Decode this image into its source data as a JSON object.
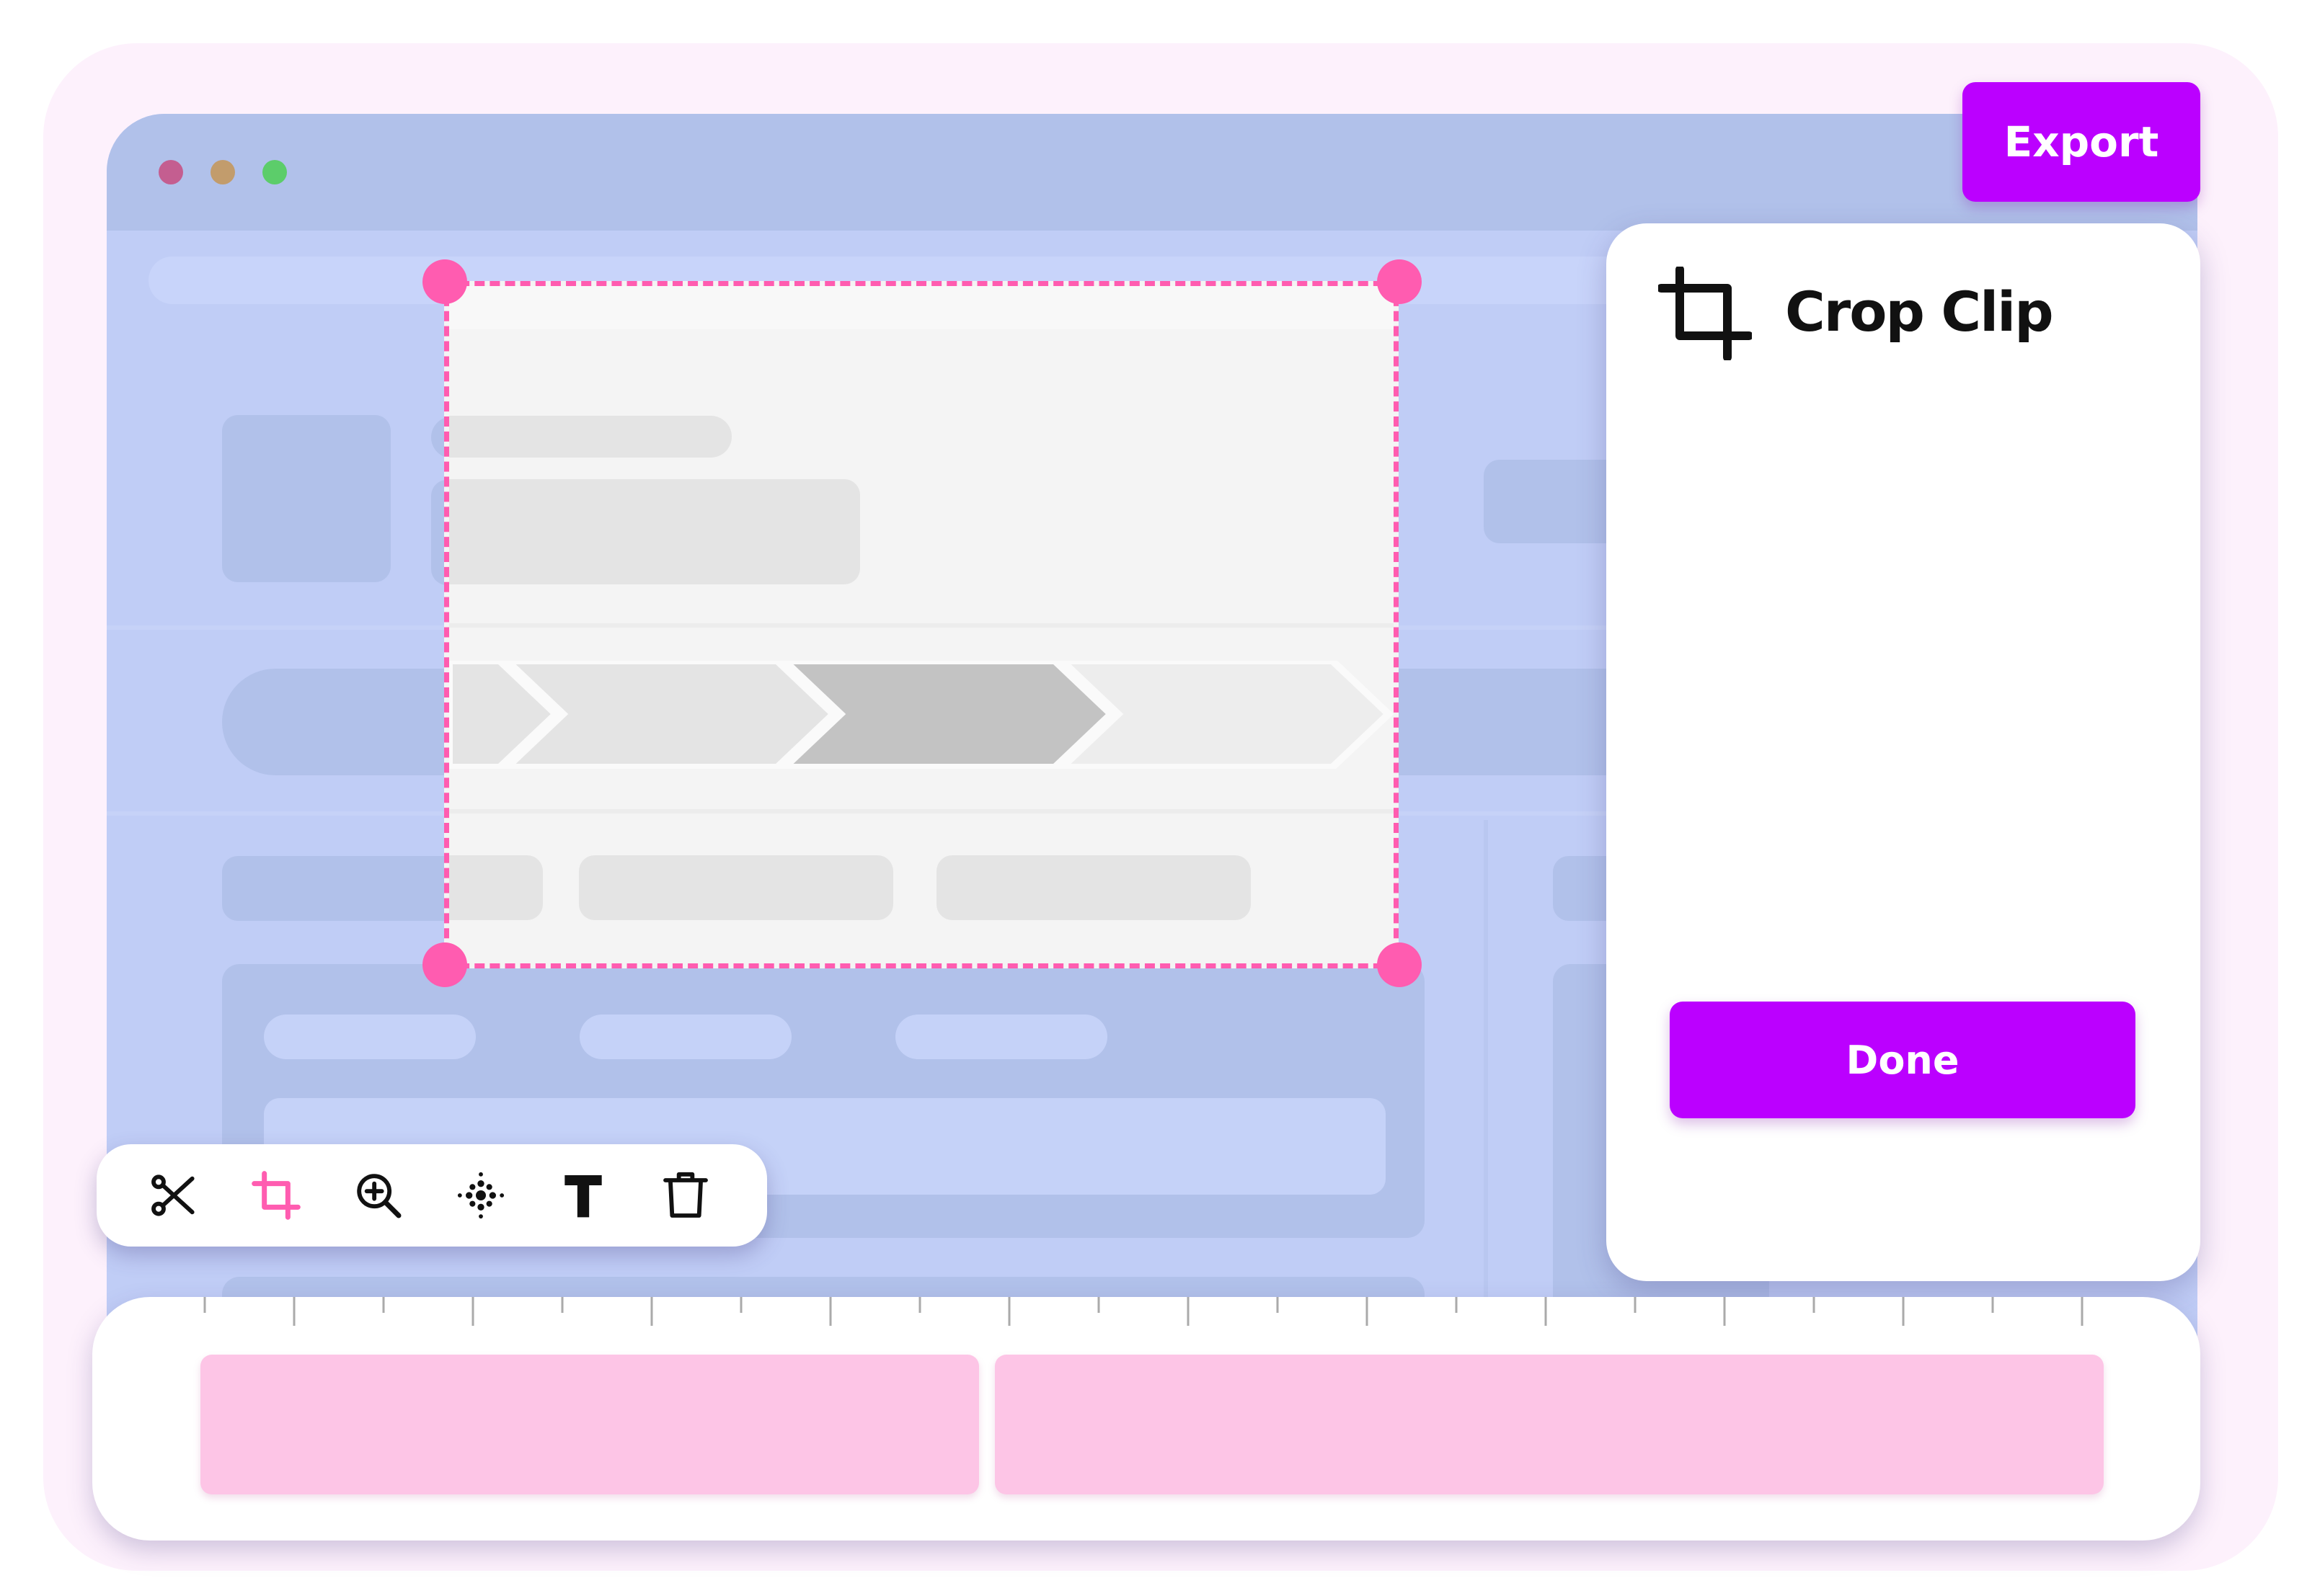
{
  "window": {
    "controls": [
      "close-dot",
      "minimize-dot",
      "maximize-dot"
    ],
    "control_colors": [
      "#c45e90",
      "#c29c6c",
      "#5ccd6a"
    ]
  },
  "header": {
    "export_label": "Export"
  },
  "crop_panel": {
    "icon": "crop-icon",
    "title": "Crop Clip",
    "done_label": "Done"
  },
  "toolbar": {
    "tools": [
      {
        "name": "scissors-icon",
        "active": false
      },
      {
        "name": "crop-icon",
        "active": true
      },
      {
        "name": "zoom-in-icon",
        "active": false
      },
      {
        "name": "sparkle-effects-icon",
        "active": false
      },
      {
        "name": "text-icon",
        "active": false
      },
      {
        "name": "trash-icon",
        "active": false
      }
    ]
  },
  "timeline": {
    "clips": 2
  },
  "colors": {
    "accent": "#bb00ff",
    "crop_frame": "#ff5cb0",
    "clip": "#fdc5e6",
    "background": "#c0cdf6"
  }
}
